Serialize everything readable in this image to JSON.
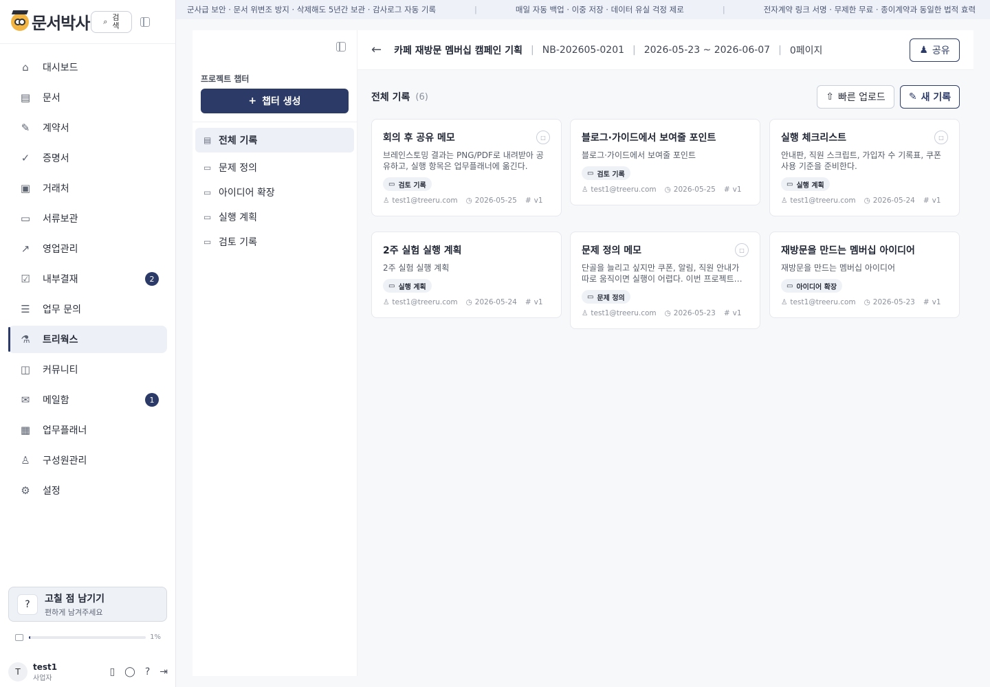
{
  "brand": {
    "name": "문서박사",
    "search_label": "검색"
  },
  "nav": [
    {
      "label": "대시보드",
      "icon": "home-icon",
      "glyph": "⌂"
    },
    {
      "label": "문서",
      "icon": "document-icon",
      "glyph": "▤"
    },
    {
      "label": "계약서",
      "icon": "contract-icon",
      "glyph": "✎"
    },
    {
      "label": "증명서",
      "icon": "certificate-icon",
      "glyph": "✓"
    },
    {
      "label": "거래처",
      "icon": "partner-icon",
      "glyph": "▣"
    },
    {
      "label": "서류보관",
      "icon": "folder-icon",
      "glyph": "▭"
    },
    {
      "label": "영업관리",
      "icon": "trend-icon",
      "glyph": "↗"
    },
    {
      "label": "내부결재",
      "icon": "clipboard-icon",
      "glyph": "☑",
      "badge": "2"
    },
    {
      "label": "업무 문의",
      "icon": "inquiry-icon",
      "glyph": "☰"
    },
    {
      "label": "트리웍스",
      "icon": "flask-icon",
      "glyph": "⚗",
      "active": true
    },
    {
      "label": "커뮤니티",
      "icon": "chat-icon",
      "glyph": "◫"
    },
    {
      "label": "메일함",
      "icon": "mail-icon",
      "glyph": "✉",
      "badge": "1"
    },
    {
      "label": "업무플래너",
      "icon": "calendar-icon",
      "glyph": "▦"
    },
    {
      "label": "구성원관리",
      "icon": "user-add-icon",
      "glyph": "♙"
    },
    {
      "label": "설정",
      "icon": "gear-icon",
      "glyph": "⚙"
    }
  ],
  "feedback": {
    "title": "고칠 점 남기기",
    "subtitle": "편하게 남겨주세요"
  },
  "storage": {
    "percent_label": "1%",
    "percent": 1
  },
  "user": {
    "initial": "T",
    "name": "test1",
    "role": "사업자"
  },
  "banner": [
    "군사급 보안 · 문서 위변조 방지 · 삭제해도 5년간 보관 · 감사로그 자동 기록",
    "매일 자동 백업 · 이중 저장 · 데이터 유실 걱정 제로",
    "전자계약 링크 서명 · 무제한 무료 · 종이계약과 동일한 법적 효력"
  ],
  "chapters": {
    "label": "프로젝트 챕터",
    "create_label": "챕터 생성",
    "items": [
      {
        "label": "전체 기록",
        "active": true
      },
      {
        "label": "문제 정의"
      },
      {
        "label": "아이디어 확장"
      },
      {
        "label": "실행 계획"
      },
      {
        "label": "검토 기록"
      }
    ]
  },
  "header": {
    "title": "카페 재방문 멤버십 캠페인 기획",
    "code": "NB-202605-0201",
    "period": "2026-05-23 ~ 2026-06-07",
    "pages": "0페이지",
    "share_label": "공유"
  },
  "list": {
    "title": "전체 기록",
    "count": "(6)",
    "upload_label": "빠른 업로드",
    "new_label": "새 기록"
  },
  "cards": [
    {
      "title": "회의 후 공유 메모",
      "desc": "브레인스토밍 결과는 PNG/PDF로 내려받아 공유하고, 실행 항목은 업무플래너에 옮긴다.",
      "tag": "검토 기록",
      "author": "test1@treeru.com",
      "date": "2026-05-25",
      "version": "v1",
      "pin": true
    },
    {
      "title": "블로그·가이드에서 보여줄 포인트",
      "desc": "블로그·가이드에서 보여줄 포인트",
      "tag": "검토 기록",
      "author": "test1@treeru.com",
      "date": "2026-05-25",
      "version": "v1",
      "pin": false
    },
    {
      "title": "실행 체크리스트",
      "desc": "안내판, 직원 스크립트, 가입자 수 기록표, 쿠폰 사용 기준을 준비한다.",
      "tag": "실행 계획",
      "author": "test1@treeru.com",
      "date": "2026-05-24",
      "version": "v1",
      "pin": true
    },
    {
      "title": "2주 실험 실행 계획",
      "desc": "2주 실험 실행 계획",
      "tag": "실행 계획",
      "author": "test1@treeru.com",
      "date": "2026-05-24",
      "version": "v1",
      "pin": false
    },
    {
      "title": "문제 정의 메모",
      "desc": "단골을 늘리고 싶지만 쿠폰, 알림, 직원 안내가 따로 움직이면 실행이 어렵다. 이번 프로젝트는 작은 카…",
      "tag": "문제 정의",
      "author": "test1@treeru.com",
      "date": "2026-05-23",
      "version": "v1",
      "pin": true
    },
    {
      "title": "재방문을 만드는 멤버십 아이디어",
      "desc": "재방문을 만드는 멤버십 아이디어",
      "tag": "아이디어 확장",
      "author": "test1@treeru.com",
      "date": "2026-05-23",
      "version": "v1",
      "pin": false
    }
  ]
}
